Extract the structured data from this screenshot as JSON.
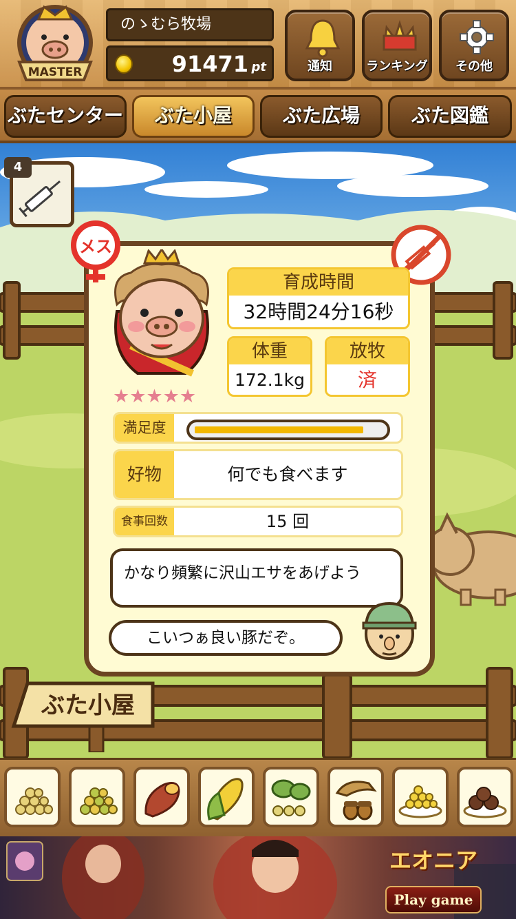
{
  "header": {
    "badge_text": "MASTER",
    "farm_name": "のゝむら牧場",
    "points": "91471",
    "points_unit": "pt",
    "buttons": [
      {
        "label": "通知",
        "icon": "bell-icon"
      },
      {
        "label": "ランキング",
        "icon": "crown-icon"
      },
      {
        "label": "その他",
        "icon": "gear-icon"
      }
    ]
  },
  "tabs": [
    {
      "label": "ぶたセンター",
      "active": false
    },
    {
      "label": "ぶた小屋",
      "active": true
    },
    {
      "label": "ぶた広場",
      "active": false
    },
    {
      "label": "ぶた図鑑",
      "active": false
    }
  ],
  "item_slot": {
    "count": "4",
    "icon": "syringe-icon"
  },
  "pig": {
    "gender_label": "メス",
    "stars": "★★★★★",
    "rating": 5,
    "growth_time": {
      "label": "育成時間",
      "value": "32時間24分16秒"
    },
    "weight": {
      "label": "体重",
      "value": "172.1kg"
    },
    "grazing": {
      "label": "放牧",
      "value": "済"
    },
    "satisfaction": {
      "label": "満足度",
      "level": 0.9
    },
    "favorite": {
      "label": "好物",
      "value": "何でも食べます"
    },
    "meals": {
      "label": "食事回数",
      "value": "15 回"
    },
    "advice": "かなり頻繁に沢山エサをあげよう",
    "farmer_comment": "こいつぁ良い豚だぞ。"
  },
  "sign": {
    "label": "ぶた小屋"
  },
  "food_items": [
    {
      "icon": "grain-pile-icon"
    },
    {
      "icon": "mixed-grain-icon"
    },
    {
      "icon": "sweet-potato-icon"
    },
    {
      "icon": "corn-icon"
    },
    {
      "icon": "beans-leaf-icon"
    },
    {
      "icon": "acorn-icon"
    },
    {
      "icon": "soy-plate-icon"
    },
    {
      "icon": "meat-balls-icon"
    }
  ],
  "ad": {
    "logo": "エオニア",
    "button": "Play game"
  },
  "colors": {
    "accent": "#fbd54b",
    "wood": "#6b4422",
    "panel": "#fffbd3",
    "star": "#e57f8f",
    "done": "#e4332b"
  }
}
